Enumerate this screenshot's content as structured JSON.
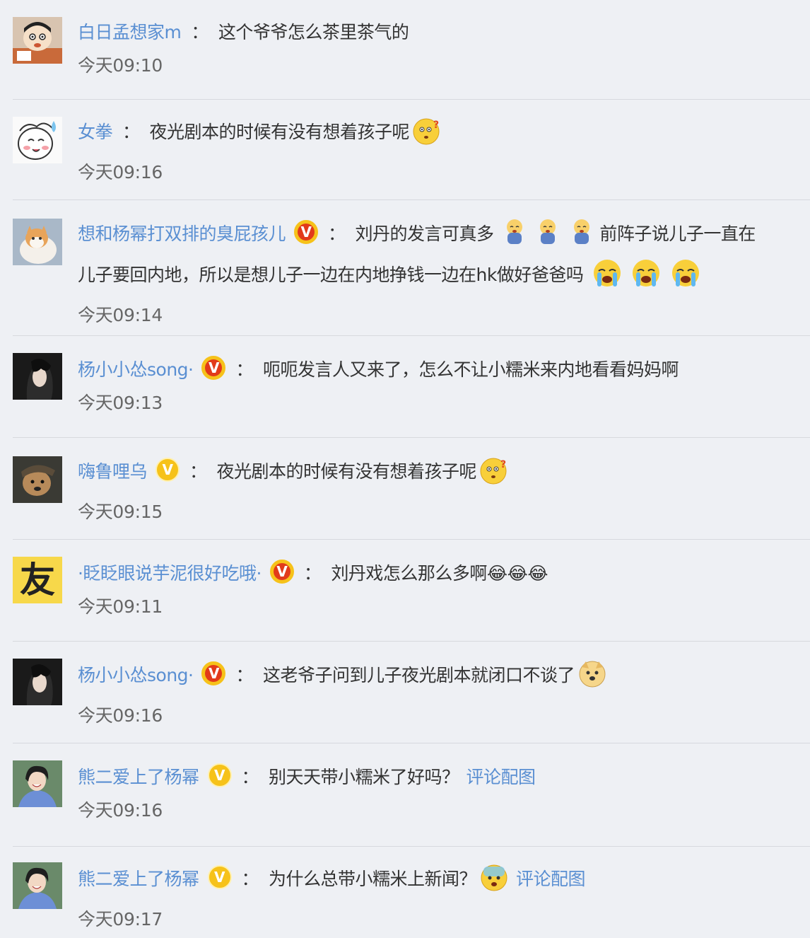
{
  "comments": [
    {
      "user": "白日孟想家m",
      "colon": "：",
      "text": "这个爷爷怎么茶里茶气的",
      "time": "今天09:10",
      "avatar": "cartoon-boy-avatar"
    },
    {
      "user": "女拳",
      "colon": "：",
      "text": "夜光剧本的时候有没有想着孩子呢",
      "time": "今天09:16",
      "avatar": "cartoon-sheep-avatar",
      "emoji": "question-face-emoji"
    },
    {
      "user": "想和杨幂打双排的臭屁孩儿",
      "colon": "：",
      "text": "刘丹的发言可真多",
      "text2": "前阵子说儿子一直在",
      "line2": "儿子要回内地，所以是想儿子一边在内地挣钱一边在hk做好爸爸吗",
      "time": "今天09:14",
      "avatar": "cat-avatar",
      "badge": "V"
    },
    {
      "user": "杨小小怂song·",
      "colon": "：",
      "text": "呃呃发言人又来了，怎么不让小糯米来内地看看妈妈啊",
      "time": "今天09:13",
      "avatar": "woman-portrait-avatar",
      "badge": "V"
    },
    {
      "user": "嗨鲁哩乌",
      "colon": "：",
      "text": "夜光剧本的时候有没有想着孩子呢",
      "time": "今天09:15",
      "avatar": "dog-photo-avatar",
      "badge": "V"
    },
    {
      "user": "·眨眨眼说芋泥很好吃哦·",
      "colon": "：",
      "text": "刘丹戏怎么那么多啊😂😂😂",
      "time": "今天09:11",
      "avatar": "you-character-avatar",
      "avatar_char": "友",
      "badge": "V"
    },
    {
      "user": "杨小小怂song·",
      "colon": "：",
      "text": "这老爷子问到儿子夜光剧本就闭口不谈了",
      "time": "今天09:16",
      "avatar": "woman-portrait-avatar",
      "badge": "V"
    },
    {
      "user": "熊二爱上了杨幂",
      "colon": "：",
      "text": "别天天带小糯米了好吗？",
      "link": "评论配图",
      "time": "今天09:16",
      "avatar": "smiling-woman-avatar",
      "badge": "V"
    },
    {
      "user": "熊二爱上了杨幂",
      "colon": "：",
      "text": "为什么总带小糯米上新闻？",
      "link": "评论配图",
      "time": "今天09:17",
      "avatar": "smiling-woman-avatar",
      "badge": "V"
    }
  ],
  "colors": {
    "link": "#5a8fd2",
    "background": "#eef0f4",
    "divider": "#d7d9de",
    "badge_red": "#e23a1a",
    "badge_gold": "#f6c21a"
  }
}
